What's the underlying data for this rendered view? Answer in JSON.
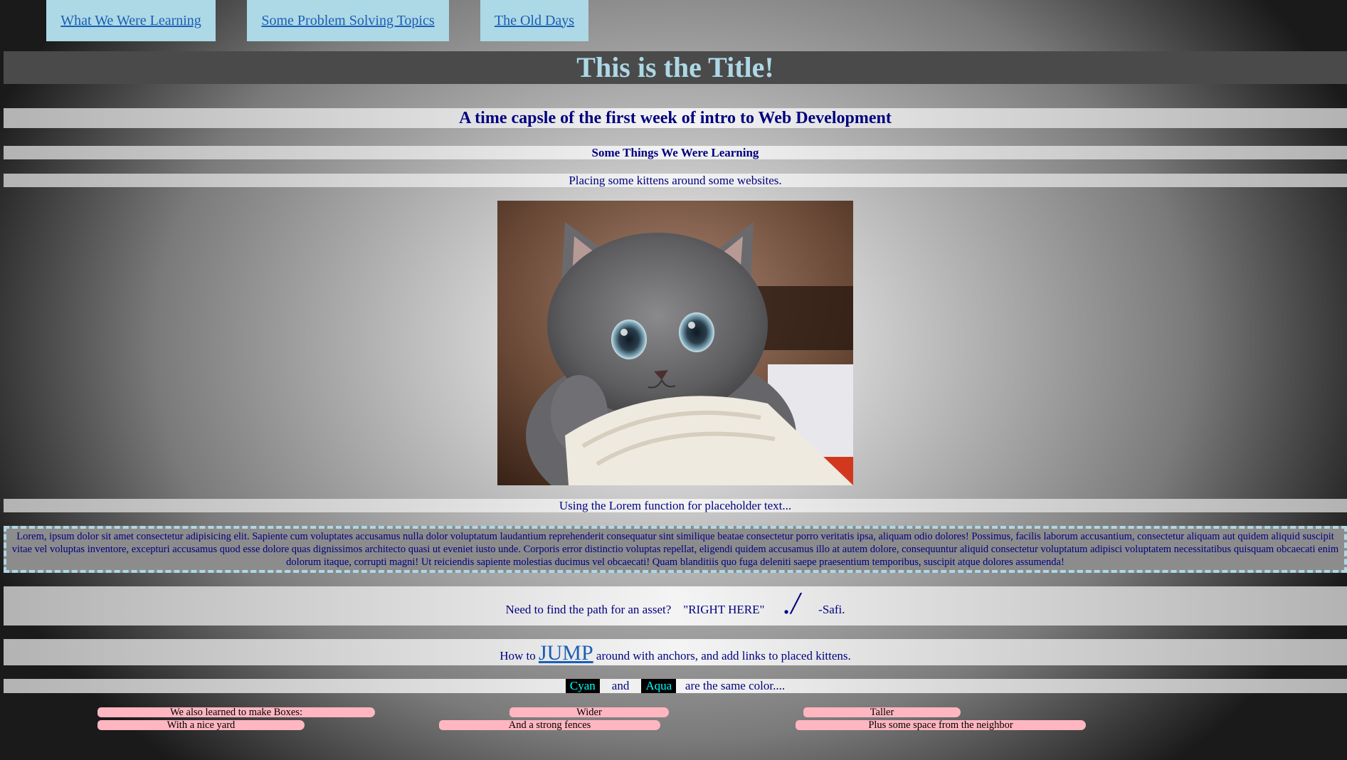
{
  "nav": {
    "items": [
      {
        "label": "What We Were Learning"
      },
      {
        "label": "Some Problem Solving Topics"
      },
      {
        "label": "The Old Days"
      }
    ]
  },
  "title": "This is the Title!",
  "subtitle": "A time capsle of the first week of intro to Web Development",
  "section_heading": "Some Things We Were Learning",
  "kitten_caption": "Placing some kittens around some websites.",
  "lorem_caption": "Using the Lorem function for placeholder text...",
  "lorem_text": "Lorem, ipsum dolor sit amet consectetur adipisicing elit. Sapiente cum voluptates accusamus nulla dolor voluptatum laudantium reprehenderit consequatur sint similique beatae consectetur porro veritatis ipsa, aliquam odio dolores! Possimus, facilis laborum accusantium, consectetur aliquam aut quidem aliquid suscipit vitae vel voluptas inventore, excepturi accusamus quod esse dolore quas dignissimos architecto quasi ut eveniet iusto unde. Corporis error distinctio voluptas repellat, eligendi quidem accusamus illo at autem dolore, consequuntur aliquid consectetur voluptatum adipisci voluptatem necessitatibus quisquam obcaecati enim dolorum itaque, corrupti magni! Ut reiciendis sapiente molestias ducimus vel obcaecati! Quam blanditiis quo fuga deleniti saepe praesentium temporibus, suscipit atque dolores assumenda!",
  "path": {
    "question": "Need to find the path for an asset?",
    "answer": "\"RIGHT HERE\"",
    "symbol": "./",
    "signature": "-Safi."
  },
  "jump_line": {
    "prefix": "How to",
    "link": "JUMP",
    "suffix": "around with anchors, and add links to placed kittens."
  },
  "colors_line": {
    "word1": "Cyan",
    "and": "and",
    "word2": "Aqua",
    "suffix": "are the same color...."
  },
  "boxes": [
    {
      "label": "We also learned to make Boxes:"
    },
    {
      "label": "Wider"
    },
    {
      "label": "Taller"
    },
    {
      "label": "With a nice yard"
    },
    {
      "label": "And a strong fences"
    },
    {
      "label": "Plus some space from the neighbor"
    }
  ],
  "colors": {
    "nav_bg": "#add8e6",
    "title_text": "#add8e6",
    "body_text": "#000080",
    "link": "#1a5fb4",
    "box_bg": "#ffb6c1",
    "cyan": "#00ffff"
  }
}
